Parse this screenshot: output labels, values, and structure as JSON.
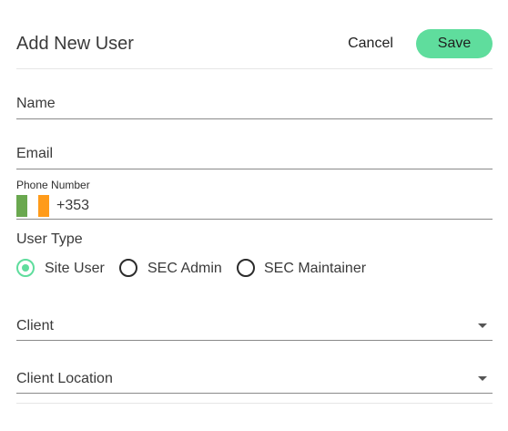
{
  "header": {
    "title": "Add New User",
    "cancel_label": "Cancel",
    "save_label": "Save"
  },
  "form": {
    "name": {
      "placeholder": "Name",
      "value": ""
    },
    "email": {
      "placeholder": "Email",
      "value": ""
    },
    "phone": {
      "label": "Phone Number",
      "country_flag": "ireland-flag",
      "dial_code": "+353",
      "value": ""
    },
    "user_type": {
      "label": "User Type",
      "options": [
        {
          "label": "Site User",
          "selected": true
        },
        {
          "label": "SEC Admin",
          "selected": false
        },
        {
          "label": "SEC Maintainer",
          "selected": false
        }
      ]
    },
    "client": {
      "placeholder": "Client",
      "selected": ""
    },
    "client_location": {
      "placeholder": "Client Location",
      "selected": ""
    }
  },
  "colors": {
    "accent": "#5fdd9d",
    "flag_green": "#6aa84f",
    "flag_white": "#ffffff",
    "flag_orange": "#ff9b1a"
  },
  "icons": {
    "radio_checked": "radio-checked-icon",
    "radio_unchecked": "radio-unchecked-icon",
    "dropdown": "chevron-down-icon"
  }
}
